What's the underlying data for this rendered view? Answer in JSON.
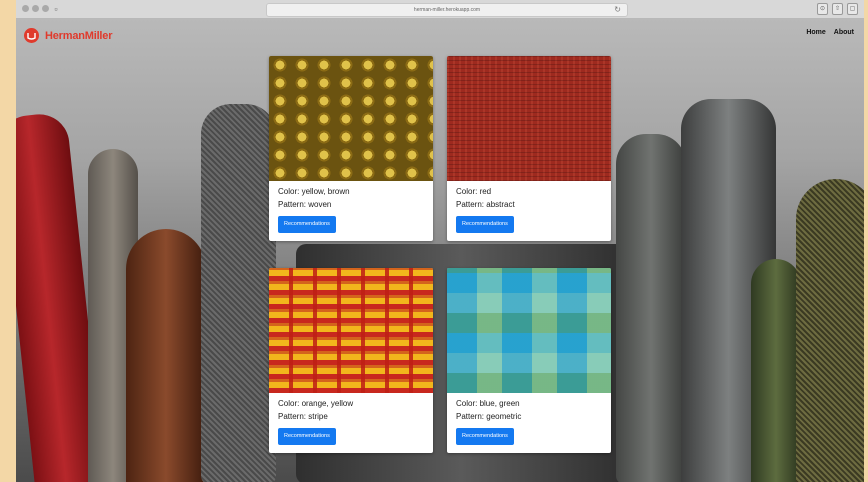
{
  "browser": {
    "url": "herman-miller.herokuapp.com"
  },
  "header": {
    "brand": "HermanMiller",
    "nav": [
      "Home",
      "About"
    ]
  },
  "products": [
    {
      "color_label": "Color: yellow, brown",
      "pattern_label": "Pattern: woven",
      "button_label": "Recommendations"
    },
    {
      "color_label": "Color: red",
      "pattern_label": "Pattern: abstract",
      "button_label": "Recommendations"
    },
    {
      "color_label": "Color: orange, yellow",
      "pattern_label": "Pattern: stripe",
      "button_label": "Recommendations"
    },
    {
      "color_label": "Color: blue, green",
      "pattern_label": "Pattern: geometric",
      "button_label": "Recommendations"
    }
  ],
  "colors": {
    "brand": "#e03a2c",
    "button": "#1479f0"
  }
}
